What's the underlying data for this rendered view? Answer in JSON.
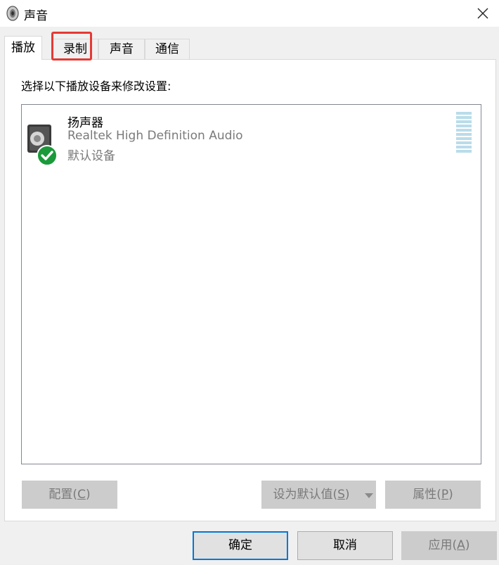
{
  "window": {
    "title": "声音",
    "app_icon": "speaker-icon",
    "close_icon": "close-icon"
  },
  "tabs": [
    {
      "label": "播放",
      "active": true
    },
    {
      "label": "录制",
      "active": false,
      "highlighted": true
    },
    {
      "label": "声音",
      "active": false
    },
    {
      "label": "通信",
      "active": false
    }
  ],
  "panel": {
    "instruction": "选择以下播放设备来修改设置:"
  },
  "devices": [
    {
      "name": "扬声器",
      "description": "Realtek High Definition Audio",
      "status": "默认设备",
      "icon": "speaker-icon",
      "badge_icon": "checkmark-icon"
    }
  ],
  "buttons": {
    "configure": {
      "text": "配置(",
      "hotkey": "C",
      "suffix": ")"
    },
    "set_default": {
      "text": "设为默认值(",
      "hotkey": "S",
      "suffix": ")"
    },
    "properties": {
      "text": "属性(",
      "hotkey": "P",
      "suffix": ")"
    }
  },
  "footer": {
    "ok": "确定",
    "cancel": "取消",
    "apply": {
      "text": "应用(",
      "hotkey": "A",
      "suffix": ")"
    }
  },
  "colors": {
    "highlight_border": "#e53935",
    "default_badge": "#1a9a3a",
    "focus_border": "#0078d7",
    "level_meter": "#b9dcea"
  }
}
